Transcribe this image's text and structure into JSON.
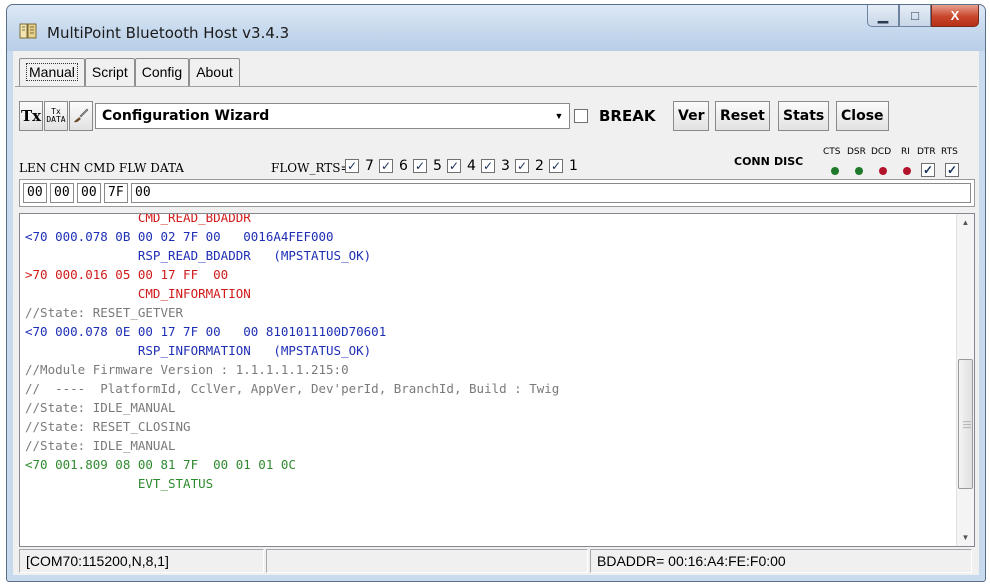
{
  "window": {
    "title": "MultiPoint Bluetooth Host v3.4.3",
    "minimize_glyph": "▁",
    "maximize_glyph": "□",
    "close_glyph": "X"
  },
  "tabs": [
    {
      "label": "Manual",
      "active": true
    },
    {
      "label": "Script"
    },
    {
      "label": "Config"
    },
    {
      "label": "About"
    }
  ],
  "toolbar": {
    "tx_label": "Tx",
    "txdata_label_top": "Tx",
    "txdata_label_bottom": "DATA",
    "brush_icon": "brush-icon",
    "combo_value": "Configuration Wizard",
    "break_label": "BREAK",
    "break_checked": false,
    "buttons": [
      "Ver",
      "Reset",
      "Stats",
      "Close"
    ]
  },
  "header": {
    "columns": "LEN CHN CMD FLW DATA",
    "flow_rts_label": "FLOW_RTS=",
    "flow_items": [
      "7",
      "6",
      "5",
      "4",
      "3",
      "2",
      "1"
    ],
    "conn_label": "CONN",
    "disc_label": "DISC",
    "signals": [
      {
        "label": "CTS",
        "kind": "led",
        "color": "#1e7a2a"
      },
      {
        "label": "DSR",
        "kind": "led",
        "color": "#1e7a2a"
      },
      {
        "label": "DCD",
        "kind": "led",
        "color": "#b3132a"
      },
      {
        "label": "RI",
        "kind": "led",
        "color": "#b3132a"
      },
      {
        "label": "DTR",
        "kind": "check"
      },
      {
        "label": "RTS",
        "kind": "check"
      }
    ]
  },
  "fields": [
    "00",
    "00",
    "00",
    "7F",
    "00"
  ],
  "log": {
    "colors": {
      "red": "#d11a1a",
      "blue": "#1f2fb5",
      "gray": "#7a7a7a",
      "green": "#2f8a2f"
    },
    "lines": [
      {
        "text": "               CMD_READ_BDADDR",
        "color": "red"
      },
      {
        "text": "<70 000.078 0B 00 02 7F 00   0016A4FEF000",
        "color": "blue"
      },
      {
        "text": "               RSP_READ_BDADDR   (MPSTATUS_OK)",
        "color": "blue"
      },
      {
        "text": ">70 000.016 05 00 17 FF  00",
        "color": "red"
      },
      {
        "text": "               CMD_INFORMATION",
        "color": "red"
      },
      {
        "text": "//State: RESET_GETVER",
        "color": "gray"
      },
      {
        "text": "<70 000.078 0E 00 17 7F 00   00 8101011100D70601",
        "color": "blue"
      },
      {
        "text": "               RSP_INFORMATION   (MPSTATUS_OK)",
        "color": "blue"
      },
      {
        "text": "//Module Firmware Version : 1.1.1.1.1.215:0",
        "color": "gray"
      },
      {
        "text": "//  ----  PlatformId, CclVer, AppVer, Dev'perId, BranchId, Build : Twig",
        "color": "gray"
      },
      {
        "text": "//State: IDLE_MANUAL",
        "color": "gray"
      },
      {
        "text": "//State: RESET_CLOSING",
        "color": "gray"
      },
      {
        "text": "//State: IDLE_MANUAL",
        "color": "gray"
      },
      {
        "text": "<70 001.809 08 00 81 7F  00 01 01 0C",
        "color": "green"
      },
      {
        "text": "               EVT_STATUS",
        "color": "green"
      }
    ]
  },
  "status": {
    "port": "[COM70:115200,N,8,1]",
    "middle": "",
    "bdaddr": "BDADDR= 00:16:A4:FE:F0:00"
  }
}
